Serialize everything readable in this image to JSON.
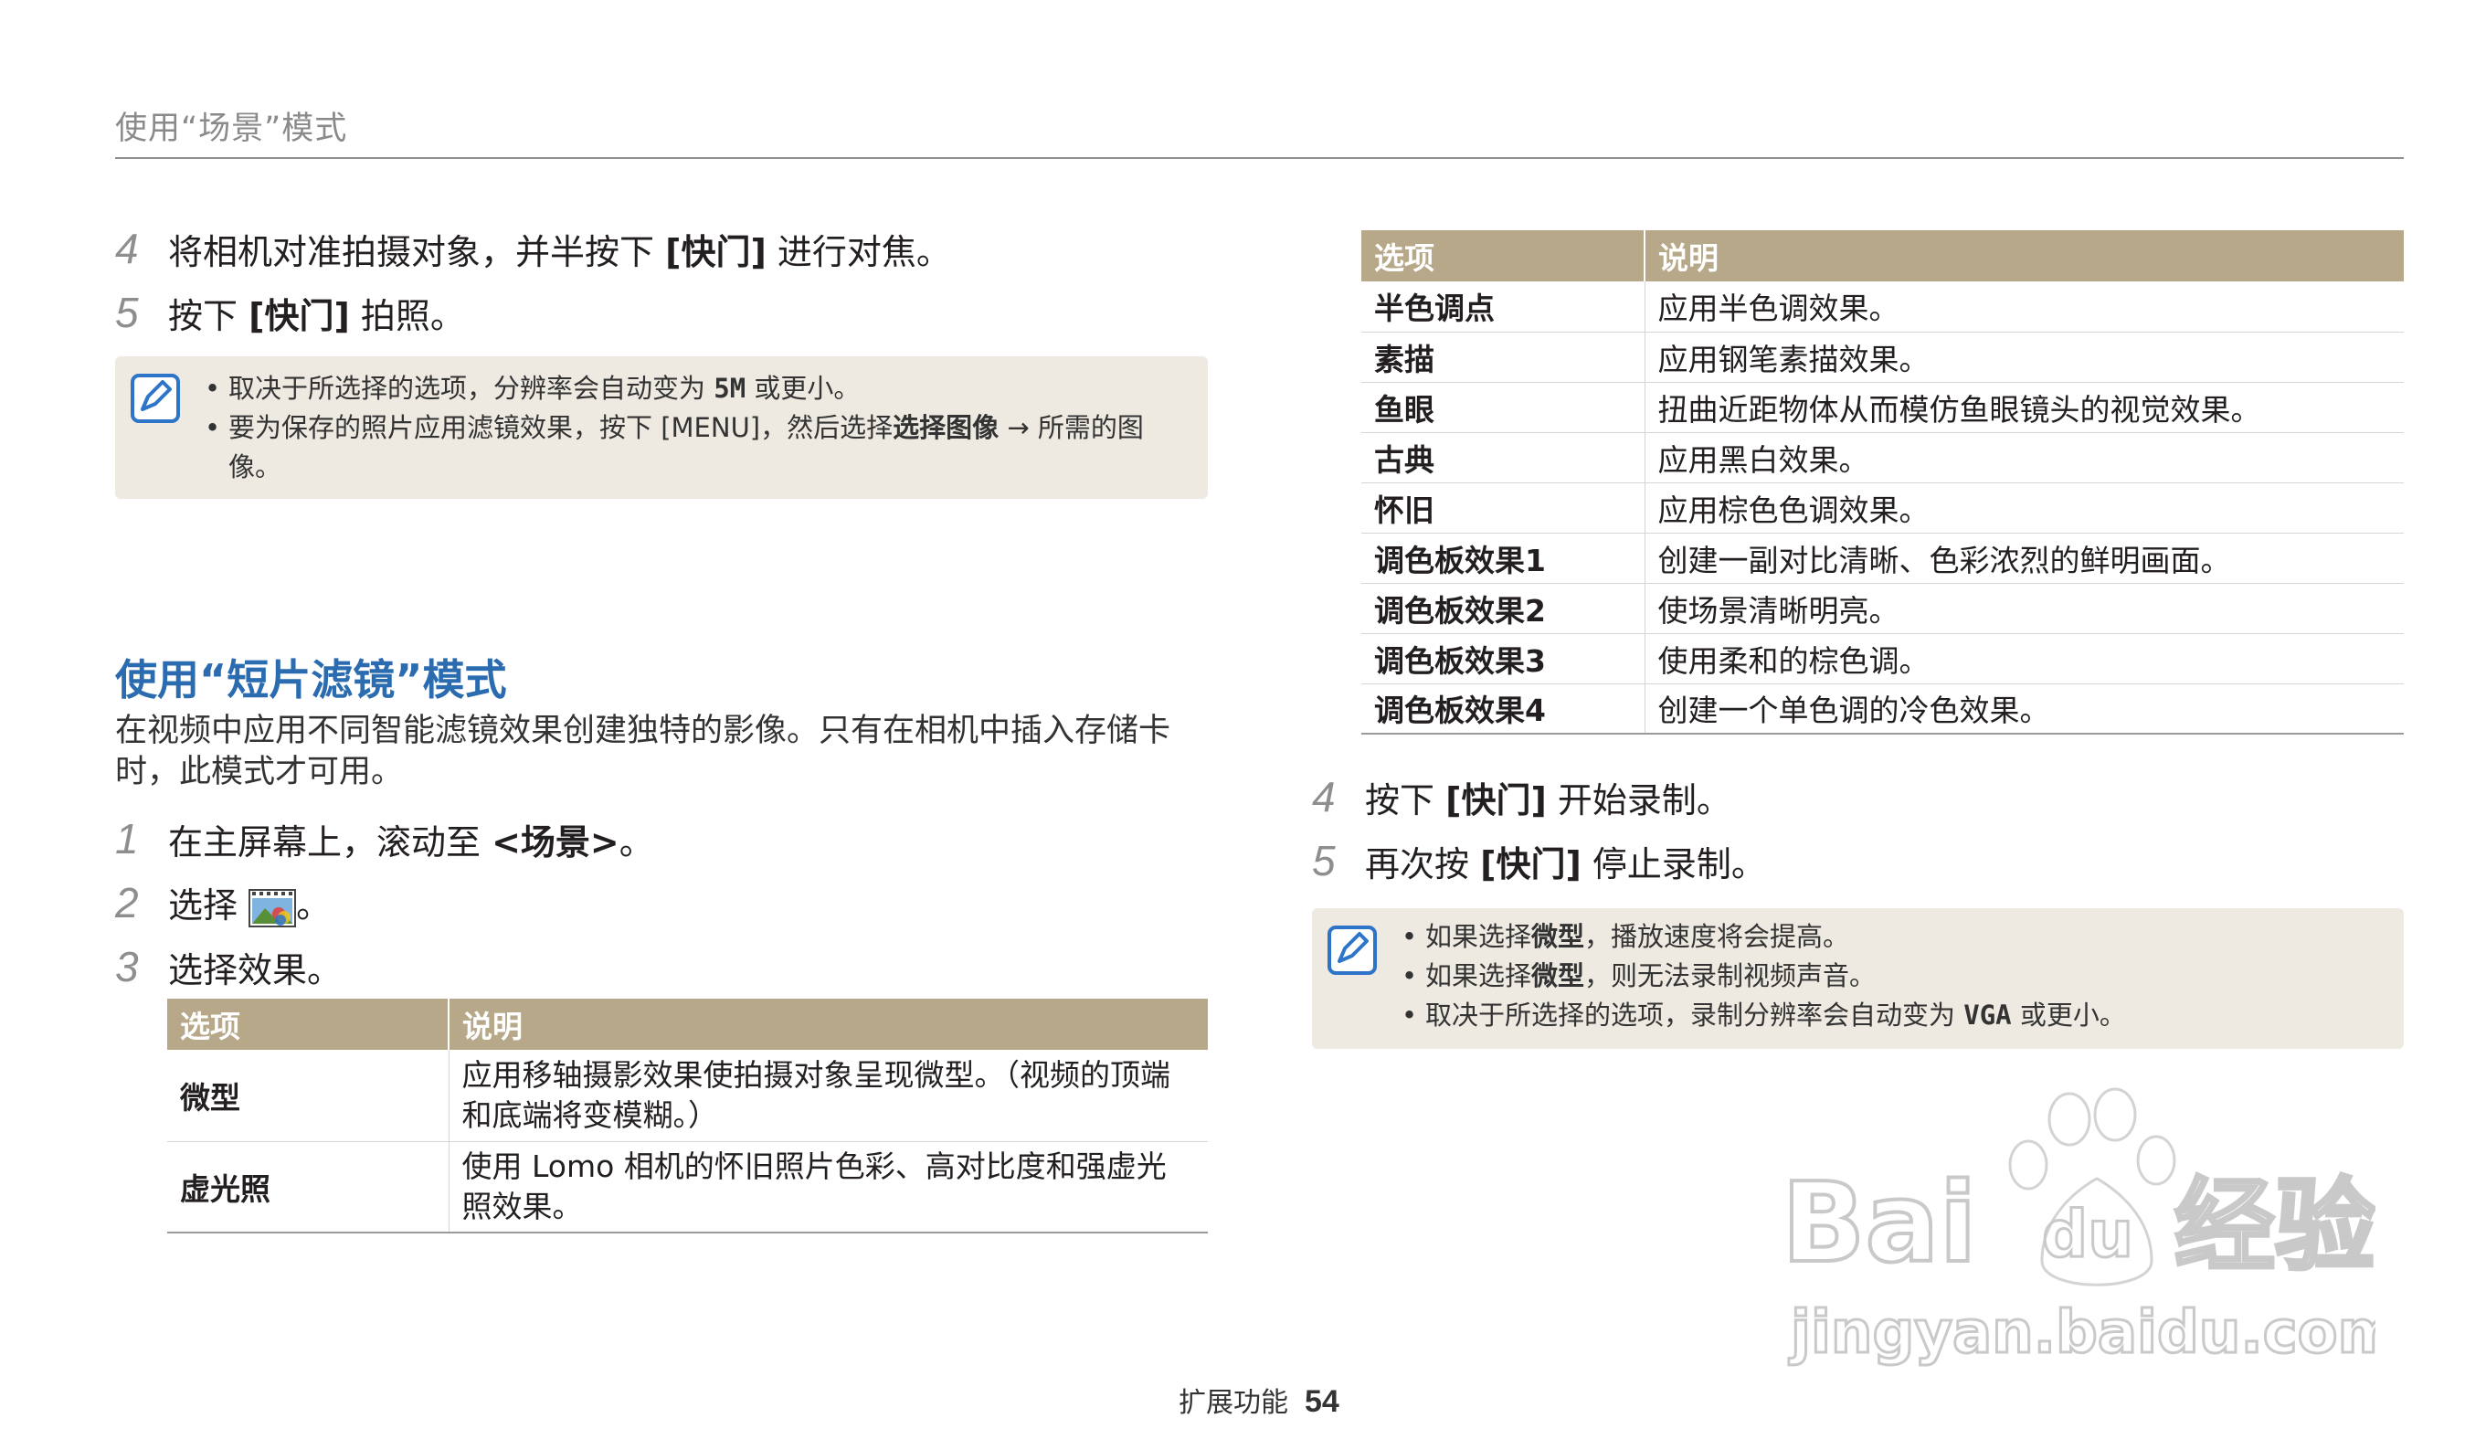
{
  "header": {
    "title": "使用“场景”模式"
  },
  "left": {
    "steps_top": [
      {
        "num": "4",
        "pre": "将相机对准拍摄对象，并半按下 ",
        "bold": "[快门]",
        "post": " 进行对焦。"
      },
      {
        "num": "5",
        "pre": "按下 ",
        "bold": "[快门]",
        "post": " 拍照。"
      }
    ],
    "note": {
      "item1_pre": "取决于所选择的选项，分辨率会自动变为 ",
      "item1_icon": "5M",
      "item1_post": " 或更小。",
      "item2_pre": "要为保存的照片应用滤镜效果，按下 [MENU]，然后选择",
      "item2_bold": "选择图像",
      "item2_post": " → 所需的图像。"
    },
    "section_title": "使用“短片滤镜”模式",
    "intro": "在视频中应用不同智能滤镜效果创建独特的影像。只有在相机中插入存储卡时，此模式才可用。",
    "step1": {
      "num": "1",
      "pre": "在主屏幕上，滚动至 ",
      "bold": "<场景>",
      "post": "。"
    },
    "step2": {
      "num": "2",
      "pre": "选择 ",
      "icon": "movie-filter-icon",
      "post": "。"
    },
    "step3": {
      "num": "3",
      "text": "选择效果。"
    },
    "table": {
      "headers": [
        "选项",
        "说明"
      ],
      "rows": [
        {
          "option": "微型",
          "desc": "应用移轴摄影效果使拍摄对象呈现微型。（视频的顶端和底端将变模糊。）"
        },
        {
          "option": "虚光照",
          "desc": "使用 Lomo 相机的怀旧照片色彩、高对比度和强虚光照效果。"
        }
      ]
    }
  },
  "right": {
    "table": {
      "headers": [
        "选项",
        "说明"
      ],
      "rows": [
        {
          "option": "半色调点",
          "desc": "应用半色调效果。"
        },
        {
          "option": "素描",
          "desc": "应用钢笔素描效果。"
        },
        {
          "option": "鱼眼",
          "desc": "扭曲近距物体从而模仿鱼眼镜头的视觉效果。"
        },
        {
          "option": "古典",
          "desc": "应用黑白效果。"
        },
        {
          "option": "怀旧",
          "desc": "应用棕色色调效果。"
        },
        {
          "option": "调色板效果1",
          "desc": "创建一副对比清晰、色彩浓烈的鲜明画面。"
        },
        {
          "option": "调色板效果2",
          "desc": "使场景清晰明亮。"
        },
        {
          "option": "调色板效果3",
          "desc": "使用柔和的棕色调。"
        },
        {
          "option": "调色板效果4",
          "desc": "创建一个单色调的冷色效果。"
        }
      ]
    },
    "steps": [
      {
        "num": "4",
        "pre": "按下 ",
        "bold": "[快门]",
        "post": " 开始录制。"
      },
      {
        "num": "5",
        "pre": "再次按 ",
        "bold": "[快门]",
        "post": " 停止录制。"
      }
    ],
    "note": {
      "item1_pre": "如果选择",
      "item1_bold": "微型",
      "item1_post": "，播放速度将会提高。",
      "item2_pre": "如果选择",
      "item2_bold": "微型",
      "item2_post": "，则无法录制视频声音。",
      "item3_pre": "取决于所选择的选项，录制分辨率会自动变为 ",
      "item3_icon": "VGA",
      "item3_post": " 或更小。"
    }
  },
  "footer": {
    "label": "扩展功能",
    "page": "54"
  },
  "watermark": {
    "brand": "Bai",
    "brand2": "du",
    "cn": "经验",
    "url": "jingyan.baidu.com"
  }
}
